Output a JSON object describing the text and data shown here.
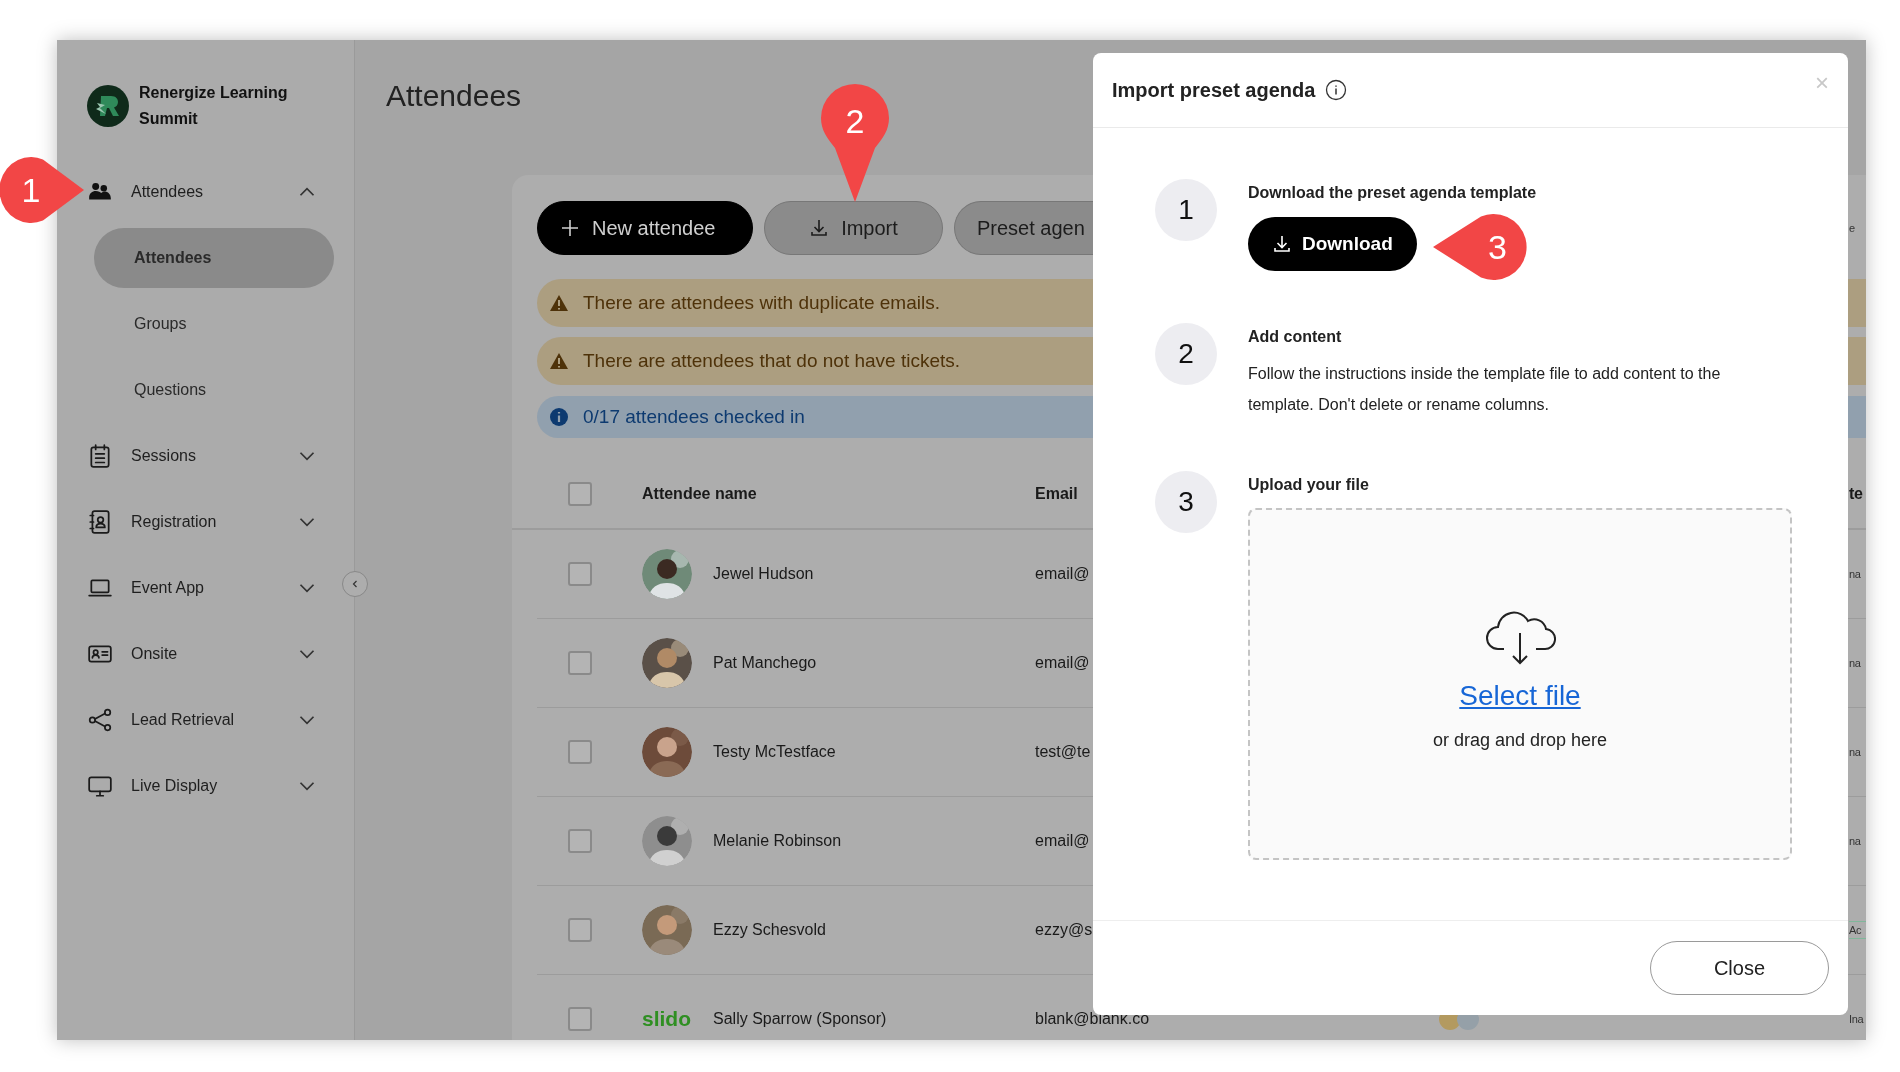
{
  "sidebar": {
    "brand": "Renergize Learning Summit",
    "items": [
      {
        "label": "Attendees",
        "expanded": true,
        "children": [
          {
            "label": "Attendees",
            "selected": true
          },
          {
            "label": "Groups",
            "selected": false
          },
          {
            "label": "Questions",
            "selected": false
          }
        ]
      },
      {
        "label": "Sessions",
        "expanded": false
      },
      {
        "label": "Registration",
        "expanded": false
      },
      {
        "label": "Event App",
        "expanded": false
      },
      {
        "label": "Onsite",
        "expanded": false
      },
      {
        "label": "Lead Retrieval",
        "expanded": false
      },
      {
        "label": "Live Display",
        "expanded": false
      }
    ]
  },
  "page": {
    "title": "Attendees",
    "edge_text": "e",
    "toolbar": [
      {
        "label": "New attendee",
        "kind": "primary"
      },
      {
        "label": "Import",
        "kind": "import"
      },
      {
        "label": "Preset agen",
        "kind": "secondary"
      }
    ],
    "alerts": [
      {
        "kind": "warning",
        "text": "There are attendees with duplicate emails."
      },
      {
        "kind": "warning",
        "text": "There are attendees that do not have tickets."
      },
      {
        "kind": "info",
        "text": "0/17 attendees checked in"
      }
    ],
    "table": {
      "select_all_checked": false,
      "columns": [
        "Attendee name",
        "Email"
      ],
      "edge_header": "te",
      "rows": [
        {
          "checked": false,
          "name": "Jewel Hudson",
          "email": "email@",
          "edge": {
            "kind": "cell",
            "text": "na"
          }
        },
        {
          "checked": false,
          "name": "Pat Manchego",
          "email": "email@",
          "edge": {
            "kind": "cell",
            "text": "na"
          }
        },
        {
          "checked": false,
          "name": "Testy McTestface",
          "email": "test@te",
          "edge": {
            "kind": "cell",
            "text": "na"
          }
        },
        {
          "checked": false,
          "name": "Melanie Robinson",
          "email": "email@",
          "edge": {
            "kind": "cell",
            "text": "na"
          }
        },
        {
          "checked": false,
          "name": "Ezzy Schesvold",
          "email": "ezzy@s",
          "edge": {
            "kind": "tag",
            "text": "Ac"
          }
        },
        {
          "kind": "sponsor",
          "checked": false,
          "logo": "slido",
          "name": "Sally Sparrow (Sponsor)",
          "email": "blank@blank.co",
          "edge": {
            "kind": "cell",
            "text": "Ina"
          },
          "group_avatars": true
        }
      ]
    }
  },
  "modal": {
    "title": "Import preset agenda",
    "close": "×",
    "steps": [
      {
        "number": "1",
        "kind": "download",
        "title": "Download the preset agenda template",
        "button": "Download"
      },
      {
        "number": "2",
        "kind": "text",
        "title": "Add content",
        "text": "Follow the instructions inside the template file to add content to the template. Don't delete or rename columns."
      },
      {
        "number": "3",
        "kind": "upload",
        "title": "Upload your file",
        "link": "Select file",
        "hint": "or drag and drop here"
      }
    ],
    "footer_button": "Close"
  },
  "callouts": [
    {
      "kind": "right",
      "number": "1"
    },
    {
      "kind": "down",
      "number": "2"
    },
    {
      "kind": "left",
      "number": "3"
    }
  ]
}
